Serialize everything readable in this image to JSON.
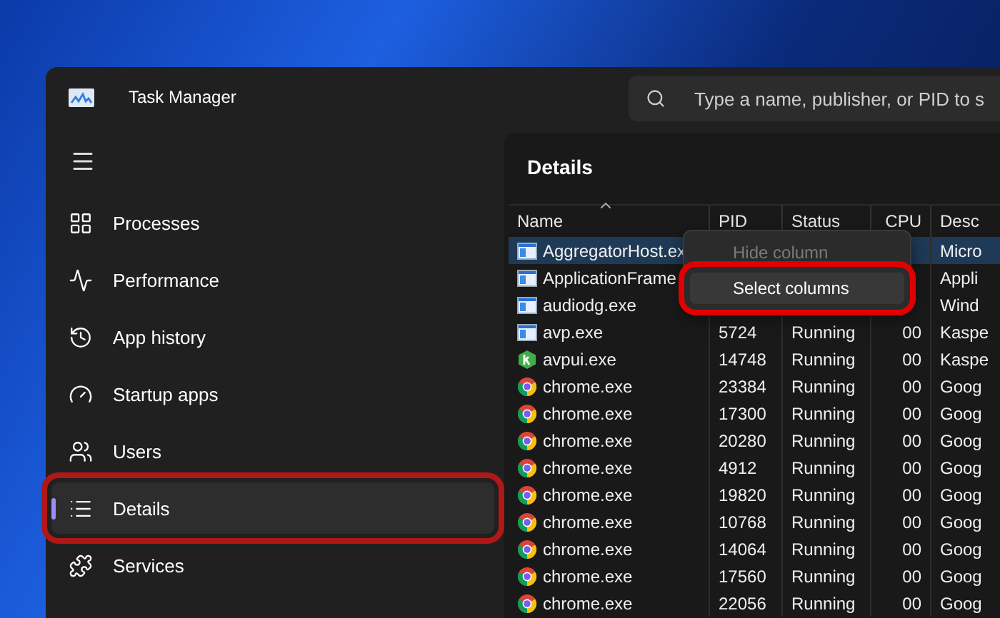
{
  "window": {
    "title": "Task Manager"
  },
  "search": {
    "placeholder": "Type a name, publisher, or PID to s"
  },
  "sidebar": {
    "items": [
      {
        "label": "Processes",
        "kind": "processes",
        "selected": false,
        "highlighted": false
      },
      {
        "label": "Performance",
        "kind": "performance",
        "selected": false,
        "highlighted": false
      },
      {
        "label": "App history",
        "kind": "history",
        "selected": false,
        "highlighted": false
      },
      {
        "label": "Startup apps",
        "kind": "startup",
        "selected": false,
        "highlighted": false
      },
      {
        "label": "Users",
        "kind": "users",
        "selected": false,
        "highlighted": false
      },
      {
        "label": "Details",
        "kind": "details",
        "selected": true,
        "highlighted": true
      },
      {
        "label": "Services",
        "kind": "services",
        "selected": false,
        "highlighted": false
      }
    ]
  },
  "page_title": "Details",
  "table": {
    "columns": [
      "Name",
      "PID",
      "Status",
      "CPU",
      "Desc"
    ],
    "rows": [
      {
        "kind": "window",
        "name": "AggregatorHost.ex",
        "desc": "Micro",
        "selected": true
      },
      {
        "kind": "window",
        "name": "ApplicationFrame",
        "desc": "Appli",
        "selected": false
      },
      {
        "kind": "window",
        "name": "audiodg.exe",
        "desc": "Wind",
        "selected": false
      },
      {
        "kind": "window",
        "name": "avp.exe",
        "pid": "5724",
        "status": "Running",
        "cpu": "00",
        "desc": "Kaspe",
        "selected": false
      },
      {
        "kind": "k",
        "name": "avpui.exe",
        "pid": "14748",
        "status": "Running",
        "cpu": "00",
        "desc": "Kaspe",
        "selected": false
      },
      {
        "kind": "chrome",
        "name": "chrome.exe",
        "pid": "23384",
        "status": "Running",
        "cpu": "00",
        "desc": "Goog",
        "selected": false
      },
      {
        "kind": "chrome",
        "name": "chrome.exe",
        "pid": "17300",
        "status": "Running",
        "cpu": "00",
        "desc": "Goog",
        "selected": false
      },
      {
        "kind": "chrome",
        "name": "chrome.exe",
        "pid": "20280",
        "status": "Running",
        "cpu": "00",
        "desc": "Goog",
        "selected": false
      },
      {
        "kind": "chrome",
        "name": "chrome.exe",
        "pid": "4912",
        "status": "Running",
        "cpu": "00",
        "desc": "Goog",
        "selected": false
      },
      {
        "kind": "chrome",
        "name": "chrome.exe",
        "pid": "19820",
        "status": "Running",
        "cpu": "00",
        "desc": "Goog",
        "selected": false
      },
      {
        "kind": "chrome",
        "name": "chrome.exe",
        "pid": "10768",
        "status": "Running",
        "cpu": "00",
        "desc": "Goog",
        "selected": false
      },
      {
        "kind": "chrome",
        "name": "chrome.exe",
        "pid": "14064",
        "status": "Running",
        "cpu": "00",
        "desc": "Goog",
        "selected": false
      },
      {
        "kind": "chrome",
        "name": "chrome.exe",
        "pid": "17560",
        "status": "Running",
        "cpu": "00",
        "desc": "Goog",
        "selected": false
      },
      {
        "kind": "chrome",
        "name": "chrome.exe",
        "pid": "22056",
        "status": "Running",
        "cpu": "00",
        "desc": "Goog",
        "selected": false
      }
    ]
  },
  "context_menu": {
    "items": [
      {
        "label": "Hide column",
        "disabled": true,
        "highlighted": false
      },
      {
        "label": "Select columns",
        "disabled": false,
        "highlighted": true
      }
    ]
  }
}
